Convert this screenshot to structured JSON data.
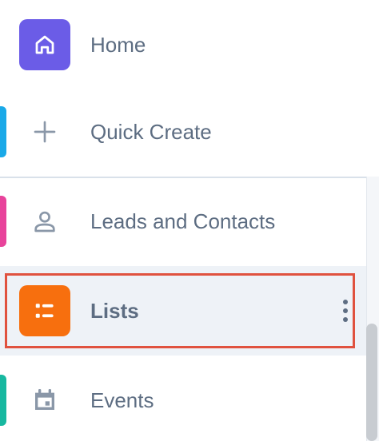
{
  "nav": {
    "items": [
      {
        "label": "Home",
        "icon": "home-icon",
        "tile_color": "#6b5ce7",
        "accent": ""
      },
      {
        "label": "Quick Create",
        "icon": "plus-icon",
        "tile_color": "",
        "accent": "#1aa9e8"
      },
      {
        "label": "Leads and Contacts",
        "icon": "user-icon",
        "tile_color": "",
        "accent": "#e8439b"
      },
      {
        "label": "Lists",
        "icon": "list-icon",
        "tile_color": "#f76f0e",
        "accent": "",
        "active": true
      },
      {
        "label": "Events",
        "icon": "calendar-icon",
        "tile_color": "",
        "accent": "#17b8a0"
      }
    ]
  },
  "colors": {
    "text": "#5d6d82",
    "active_background": "#eef2f7",
    "highlight_border": "#e0523f"
  }
}
